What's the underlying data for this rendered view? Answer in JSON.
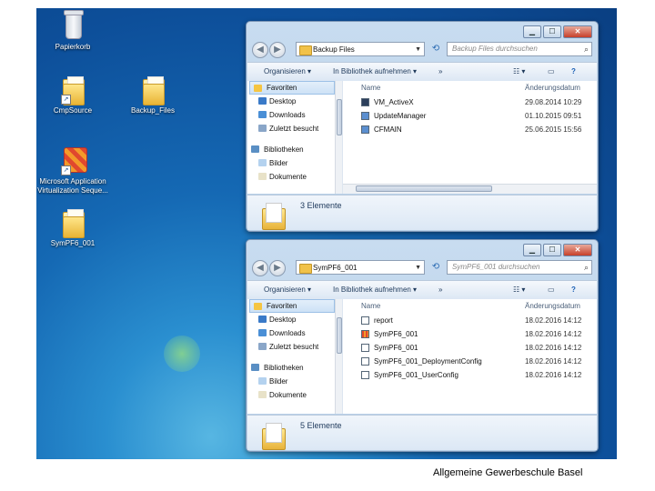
{
  "desktop": {
    "icons": [
      {
        "label": "Papierkorb",
        "icon": "recycle-bin-icon"
      },
      {
        "label": "CmpSource",
        "icon": "folder-icon"
      },
      {
        "label": "Backup_Files",
        "icon": "folder-icon"
      },
      {
        "label": "Microsoft Application Virtualization Seque...",
        "icon": "package-icon"
      },
      {
        "label": "SymPF6_001",
        "icon": "folder-icon"
      }
    ]
  },
  "window1": {
    "address": "Backup Files",
    "search_placeholder": "Backup Files durchsuchen",
    "toolbar": {
      "organize": "Organisieren ▾",
      "library": "In Bibliothek aufnehmen ▾",
      "more": "»"
    },
    "nav": {
      "favorites": "Favoriten",
      "desktop": "Desktop",
      "downloads": "Downloads",
      "recent": "Zuletzt besucht",
      "libraries": "Bibliotheken",
      "pictures": "Bilder",
      "documents": "Dokumente"
    },
    "columns": {
      "name": "Name",
      "date": "Änderungsdatum"
    },
    "files": [
      {
        "name": "VM_ActiveX",
        "date": "29.08.2014 10:29"
      },
      {
        "name": "UpdateManager",
        "date": "01.10.2015 09:51"
      },
      {
        "name": "CFMAIN",
        "date": "25.06.2015 15:56"
      }
    ],
    "status": "3 Elemente"
  },
  "window2": {
    "address": "SymPF6_001",
    "search_placeholder": "SymPF6_001 durchsuchen",
    "toolbar": {
      "organize": "Organisieren ▾",
      "library": "In Bibliothek aufnehmen ▾",
      "more": "»"
    },
    "nav": {
      "favorites": "Favoriten",
      "desktop": "Desktop",
      "downloads": "Downloads",
      "recent": "Zuletzt besucht",
      "libraries": "Bibliotheken",
      "pictures": "Bilder",
      "documents": "Dokumente"
    },
    "columns": {
      "name": "Name",
      "date": "Änderungsdatum"
    },
    "files": [
      {
        "name": "report",
        "date": "18.02.2016 14:12"
      },
      {
        "name": "SymPF6_001",
        "date": "18.02.2016 14:12"
      },
      {
        "name": "SymPF6_001",
        "date": "18.02.2016 14:12"
      },
      {
        "name": "SymPF6_001_DeploymentConfig",
        "date": "18.02.2016 14:12"
      },
      {
        "name": "SymPF6_001_UserConfig",
        "date": "18.02.2016 14:12"
      }
    ],
    "status": "5 Elemente"
  },
  "footer": "Allgemeine Gewerbeschule Basel"
}
